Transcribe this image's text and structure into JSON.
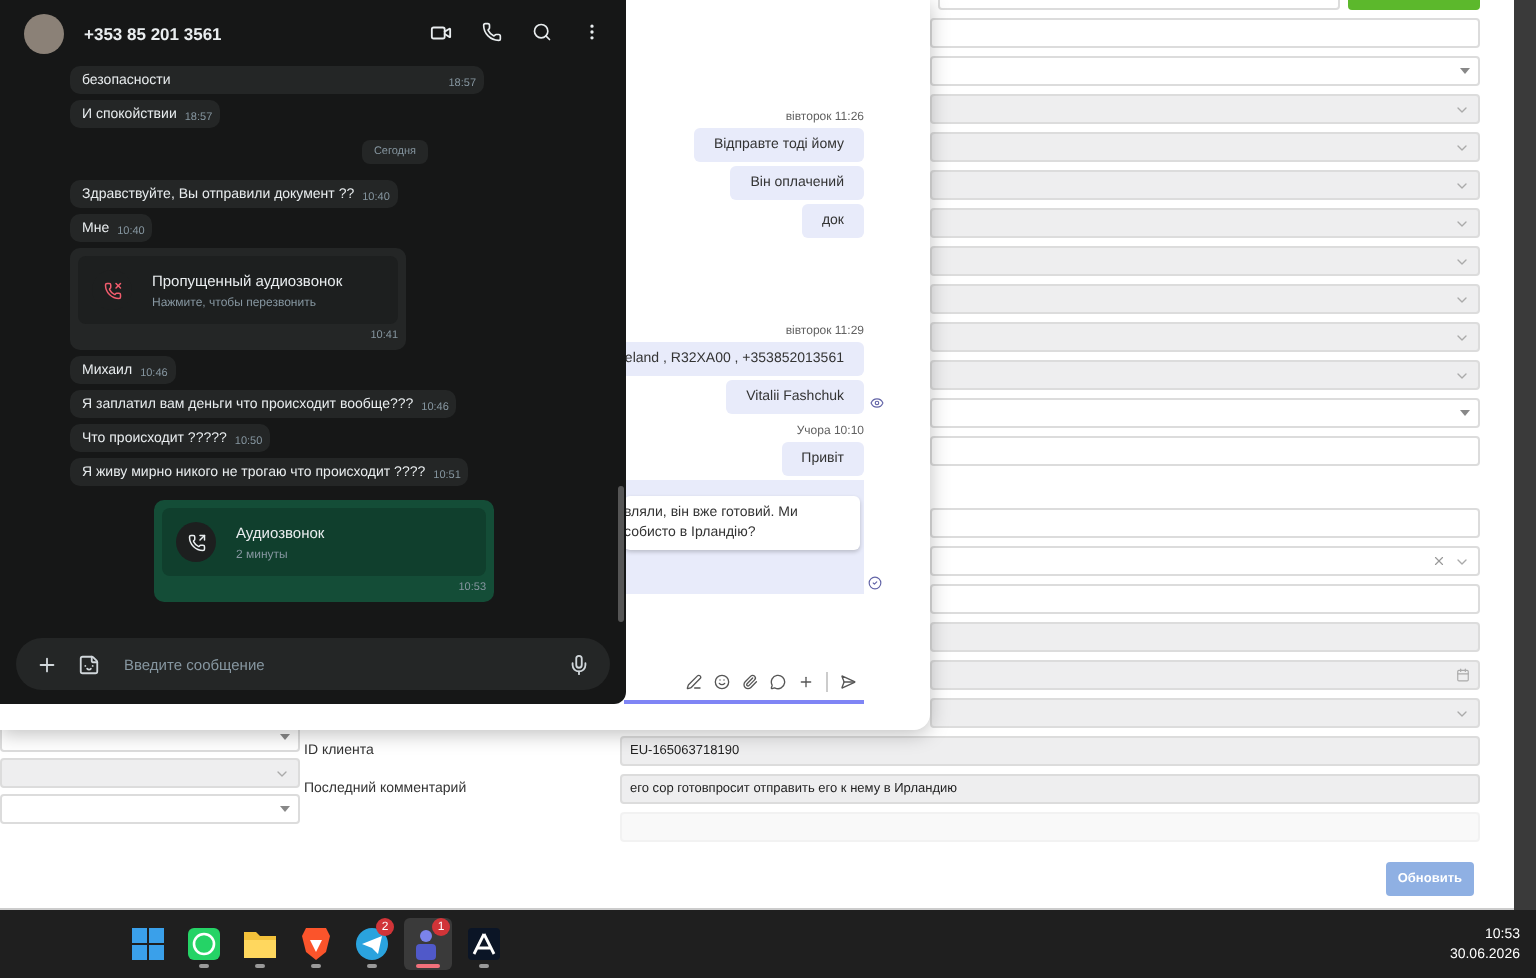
{
  "crm": {
    "left_fields": [
      {
        "kind": "select"
      },
      {
        "kind": "select_disabled"
      },
      {
        "kind": "select"
      }
    ],
    "rows": [
      {
        "kind": "top_action"
      },
      {
        "kind": "input"
      },
      {
        "kind": "select"
      },
      {
        "kind": "select_disabled"
      },
      {
        "kind": "select_disabled"
      },
      {
        "kind": "select_disabled"
      },
      {
        "kind": "select_disabled"
      },
      {
        "kind": "select_disabled"
      },
      {
        "kind": "select_disabled"
      },
      {
        "kind": "select_disabled"
      },
      {
        "kind": "select_disabled"
      },
      {
        "kind": "select"
      },
      {
        "kind": "input"
      },
      {
        "kind": "spacer"
      },
      {
        "kind": "input"
      },
      {
        "kind": "clearable"
      },
      {
        "kind": "input"
      },
      {
        "kind": "text_disabled"
      },
      {
        "kind": "date_disabled"
      },
      {
        "kind": "select_disabled"
      },
      {
        "kind": "text_disabled",
        "label": "ID клиента",
        "value": "EU-165063718190"
      },
      {
        "kind": "text_disabled",
        "label": "Последний комментарий",
        "value": "его сор готовпросит отправить его к нему в Ирландию"
      },
      {
        "kind": "faded"
      }
    ],
    "update_button": "Обновить"
  },
  "teams_chat": {
    "messages": [
      {
        "kind": "stamp",
        "text": "вівторок 11:26"
      },
      {
        "kind": "bubble",
        "text": "Відправте тоді йому"
      },
      {
        "kind": "bubble",
        "text": "Він оплачений"
      },
      {
        "kind": "bubble",
        "text": "док"
      },
      {
        "kind": "gap"
      },
      {
        "kind": "stamp",
        "text": "вівторок 11:29"
      },
      {
        "kind": "bubble",
        "text": "eland , R32XA00 , +353852013561"
      },
      {
        "kind": "bubble",
        "text": "Vitalii Fashchuk",
        "seen": true
      },
      {
        "kind": "stamp",
        "text": "Учора 10:10"
      },
      {
        "kind": "bubble",
        "text": "Привіт"
      },
      {
        "kind": "quote",
        "lines": [
          "вляли, він вже готовий. Ми",
          "собисто в Ірландію?"
        ],
        "delivered": true
      }
    ]
  },
  "whatsapp": {
    "contact": "+353 85 201 3561",
    "messages": [
      {
        "kind": "text",
        "text": "безопасности",
        "time": "18:57",
        "wide": true
      },
      {
        "kind": "text",
        "text": "И спокойствии",
        "time": "18:57"
      },
      {
        "kind": "date",
        "text": "Сегодня"
      },
      {
        "kind": "text",
        "text": "Здравствуйте, Вы отправили документ ??",
        "time": "10:40"
      },
      {
        "kind": "text",
        "text": "Мне",
        "time": "10:40"
      },
      {
        "kind": "missed_call",
        "title": "Пропущенный аудиозвонок",
        "subtitle": "Нажмите, чтобы перезвонить",
        "time": "10:41"
      },
      {
        "kind": "text",
        "text": "Михаил",
        "time": "10:46"
      },
      {
        "kind": "text",
        "text": "Я заплатил вам деньги что происходит вообще???",
        "time": "10:46"
      },
      {
        "kind": "text",
        "text": "Что происходит ?????",
        "time": "10:50"
      },
      {
        "kind": "text",
        "text": "Я живу мирно никого не трогаю что происходит ????",
        "time": "10:51"
      },
      {
        "kind": "call",
        "title": "Аудиозвонок",
        "subtitle": "2 минуты",
        "time": "10:53"
      }
    ],
    "composer": {
      "placeholder": "Введите сообщение"
    }
  },
  "taskbar": {
    "apps": [
      {
        "kind": "start",
        "running": false,
        "selected": false
      },
      {
        "kind": "whatsapp",
        "running": true,
        "selected": false
      },
      {
        "kind": "folder",
        "running": true,
        "selected": false
      },
      {
        "kind": "brave",
        "running": true,
        "selected": false
      },
      {
        "kind": "telegram",
        "running": true,
        "selected": false,
        "badge": "2"
      },
      {
        "kind": "teams",
        "running": true,
        "selected": true,
        "badge": "1"
      },
      {
        "kind": "acrobat",
        "running": true,
        "selected": false
      }
    ],
    "time": "10:53",
    "date": "30.06.2026"
  }
}
